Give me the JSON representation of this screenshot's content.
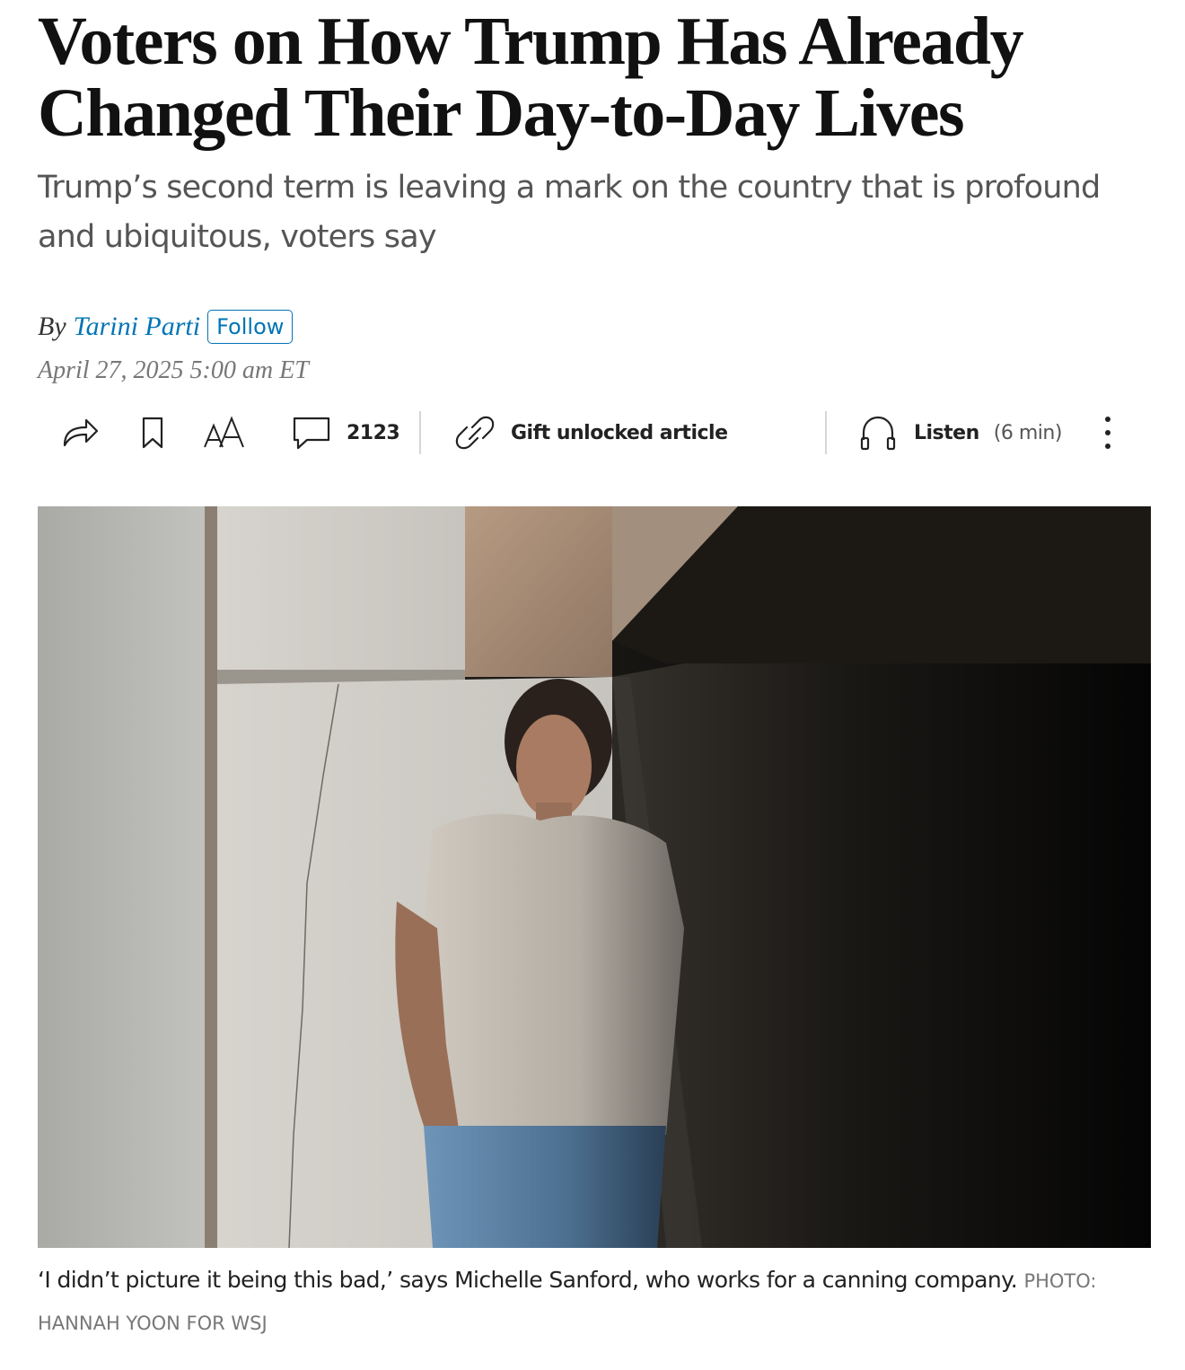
{
  "article": {
    "headline": "Voters on How Trump Has Already Changed Their Day-to-Day Lives",
    "dek": "Trump’s second term is leaving a mark on the country that is profound and ubiquitous, voters say",
    "byline_prefix": "By",
    "author": "Tarini Parti",
    "follow_label": "Follow",
    "dateline": "April 27, 2025 5:00 am ET"
  },
  "toolbar": {
    "comment_count": "2123",
    "gift_label": "Gift unlocked article",
    "listen_label": "Listen",
    "listen_duration": "(6 min)",
    "icons": [
      "share-icon",
      "bookmark-icon",
      "text-size-icon",
      "comment-icon",
      "link-icon",
      "headphones-icon",
      "more-icon"
    ]
  },
  "photo": {
    "caption": "‘I didn’t picture it being this bad,’ says Michelle Sanford, who works for a canning company.",
    "credit": "PHOTO: HANNAH YOON FOR WSJ"
  },
  "colors": {
    "link": "#0274b6",
    "headline": "#111111",
    "dek": "#555555",
    "muted": "#777777"
  }
}
